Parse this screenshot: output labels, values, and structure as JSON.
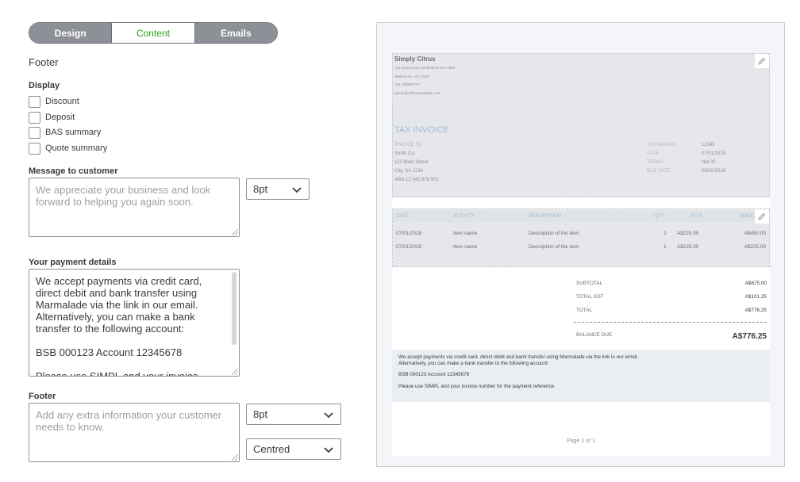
{
  "tabs": [
    {
      "label": "Design"
    },
    {
      "label": "Content"
    },
    {
      "label": "Emails"
    }
  ],
  "section_title": "Footer",
  "display": {
    "label": "Display",
    "options": [
      {
        "label": "Discount",
        "checked": false
      },
      {
        "label": "Deposit",
        "checked": false
      },
      {
        "label": "BAS summary",
        "checked": false
      },
      {
        "label": "Quote summary",
        "checked": false
      }
    ]
  },
  "message": {
    "label": "Message to customer",
    "placeholder": "We appreciate your business and look forward to helping you again soon.",
    "font_size": "8pt"
  },
  "payment": {
    "label": "Your payment details",
    "line1": "We accept payments via credit card, direct debit and bank transfer using Marmalade via the link in our email. Alternatively, you can make a bank transfer to the following account:",
    "line2": "BSB 000123 Account 12345678",
    "line3": "Please use SIMPL and your invoice"
  },
  "footer": {
    "label": "Footer",
    "placeholder": "Add any extra information your customer needs to know.",
    "font_size": "8pt",
    "alignment": "Centred"
  },
  "preview": {
    "company": "Simply Citrus",
    "address": [
      "121 King Street, Melbourne VIC 3000",
      "Melbourne, VIC 3000",
      "+61 438903797",
      "admin@withmarmalade.com"
    ],
    "title": "TAX INVOICE",
    "invoice_to_label": "INVOICE TO",
    "invoice_to": [
      "Smith Co.",
      "123 Main Street",
      "City, SA 1234",
      "ABN 12 345 678 901"
    ],
    "meta_keys": [
      "TAX INVOICE",
      "DATE",
      "TERMS",
      "DUE DATE"
    ],
    "meta_values": [
      "12345",
      "07/01/2018",
      "Net 30",
      "06/02/2018"
    ],
    "columns": [
      "DATE",
      "ACTIVITY",
      "DESCRIPTION",
      "QTY",
      "RATE",
      "AMOU"
    ],
    "rows": [
      {
        "date": "07/01/2018",
        "activity": "Item name",
        "description": "Description of the item",
        "qty": "2",
        "rate": "A$225.00",
        "amount": "A$450.00"
      },
      {
        "date": "07/01/2018",
        "activity": "Item name",
        "description": "Description of the item",
        "qty": "1",
        "rate": "A$225.00",
        "amount": "A$225.00"
      }
    ],
    "totals": [
      {
        "label": "SUBTOTAL",
        "value": "A$675.00"
      },
      {
        "label": "TOTAL GST",
        "value": "A$101.25"
      },
      {
        "label": "TOTAL",
        "value": "A$776.25"
      }
    ],
    "balance_label": "BALANCE DUE",
    "balance_value": "A$776.25",
    "payment_lines": [
      "We accept payments via credit card, direct debit and bank transfer using Marmalade via the link in our email.",
      "Alternatively, you can make a bank transfer to the following account:",
      "BSB 000123 Account 12345678",
      "Please use SIMPL and your invoice number for the payment reference."
    ],
    "page_label": "Page 1 of 1"
  },
  "colors": {
    "accent": "#2ca01c",
    "tab_inactive": "#8d9096",
    "preview_blue": "#9fbad0"
  }
}
